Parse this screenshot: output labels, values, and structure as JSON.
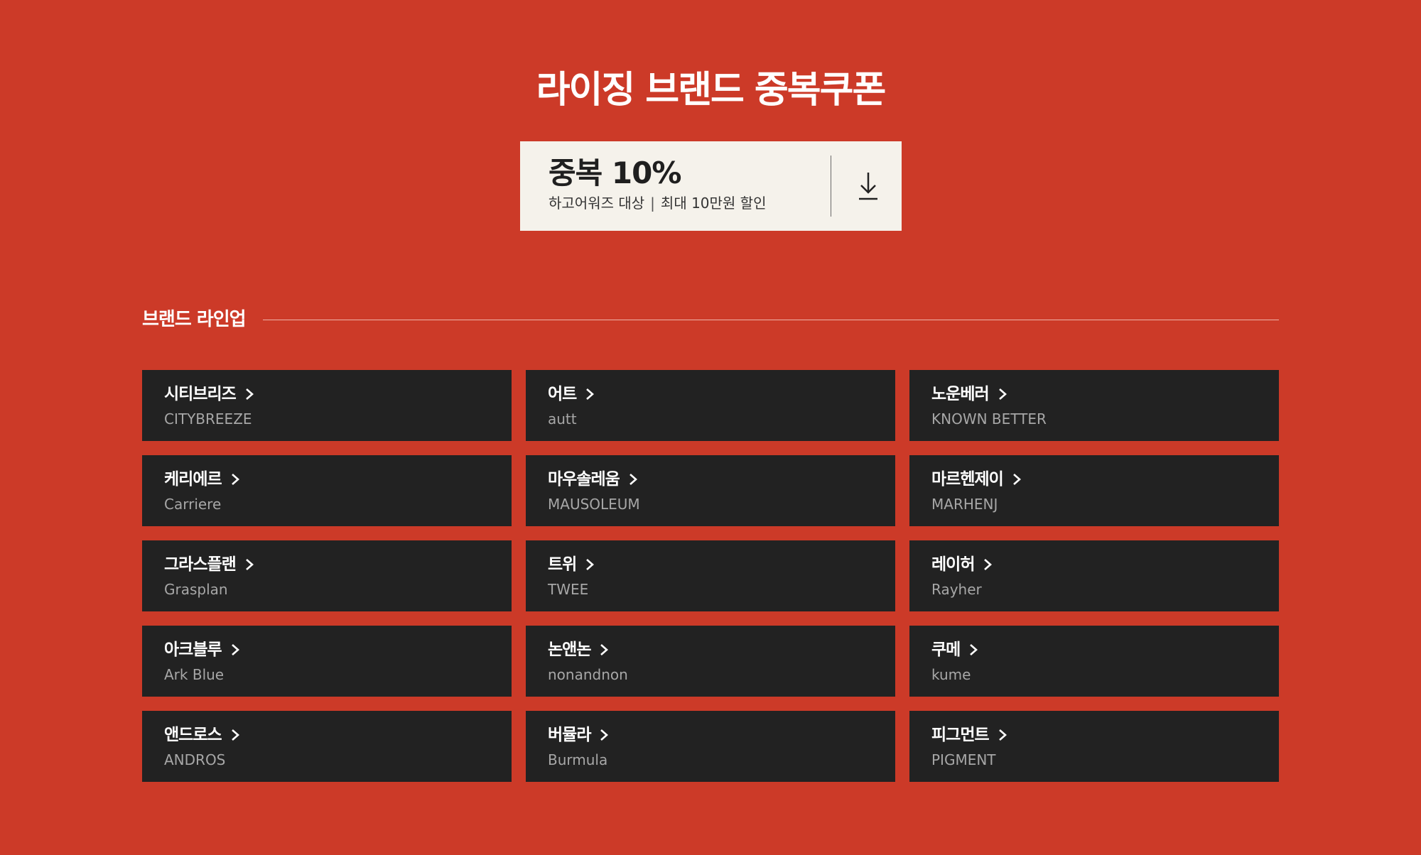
{
  "header": {
    "title": "라이징 브랜드 중복쿠폰"
  },
  "coupon": {
    "title": "중복 10%",
    "desc_left": "하고어워즈 대상",
    "desc_sep": "|",
    "desc_right": "최대 10만원 할인",
    "download_icon": "download-icon"
  },
  "section": {
    "title": "브랜드 라인업"
  },
  "brands": [
    {
      "name": "시티브리즈",
      "en": "CITYBREEZE"
    },
    {
      "name": "어트",
      "en": "autt"
    },
    {
      "name": "노운베러",
      "en": "KNOWN BETTER"
    },
    {
      "name": "케리에르",
      "en": "Carriere"
    },
    {
      "name": "마우솔레움",
      "en": "MAUSOLEUM"
    },
    {
      "name": "마르헨제이",
      "en": "MARHENJ"
    },
    {
      "name": "그라스플랜",
      "en": "Grasplan"
    },
    {
      "name": "트위",
      "en": "TWEE"
    },
    {
      "name": "레이허",
      "en": "Rayher"
    },
    {
      "name": "아크블루",
      "en": "Ark Blue"
    },
    {
      "name": "논앤논",
      "en": "nonandnon"
    },
    {
      "name": "쿠메",
      "en": "kume"
    },
    {
      "name": "앤드로스",
      "en": "ANDROS"
    },
    {
      "name": "버뮬라",
      "en": "Burmula"
    },
    {
      "name": "피그먼트",
      "en": "PIGMENT"
    }
  ],
  "colors": {
    "background": "#cc3a28",
    "card": "#222222",
    "coupon_bg": "#f5f2eb"
  }
}
